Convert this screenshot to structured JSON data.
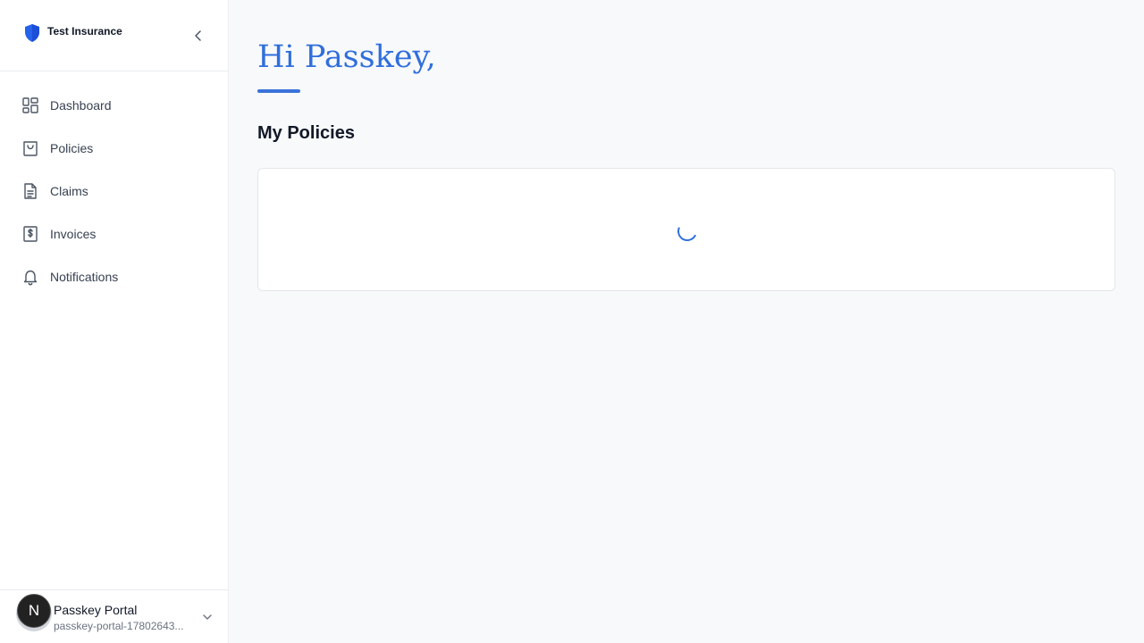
{
  "brand": {
    "name": "Test Insurance",
    "logo_icon": "shield-icon",
    "accent": "#2563eb"
  },
  "sidebar": {
    "items": [
      {
        "label": "Dashboard",
        "icon": "dashboard-grid-icon"
      },
      {
        "label": "Policies",
        "icon": "shopping-bag-icon"
      },
      {
        "label": "Claims",
        "icon": "document-icon"
      },
      {
        "label": "Invoices",
        "icon": "dollar-receipt-icon"
      },
      {
        "label": "Notifications",
        "icon": "bell-icon"
      }
    ]
  },
  "user": {
    "avatar_letter": "N",
    "name": "Passkey Portal",
    "email": "passkey-portal-17802643..."
  },
  "main": {
    "greeting": "Hi Passkey,",
    "section_title": "My Policies",
    "loading": true
  },
  "colors": {
    "greeting": "#2f6fdc",
    "background": "#f8f9fb"
  }
}
